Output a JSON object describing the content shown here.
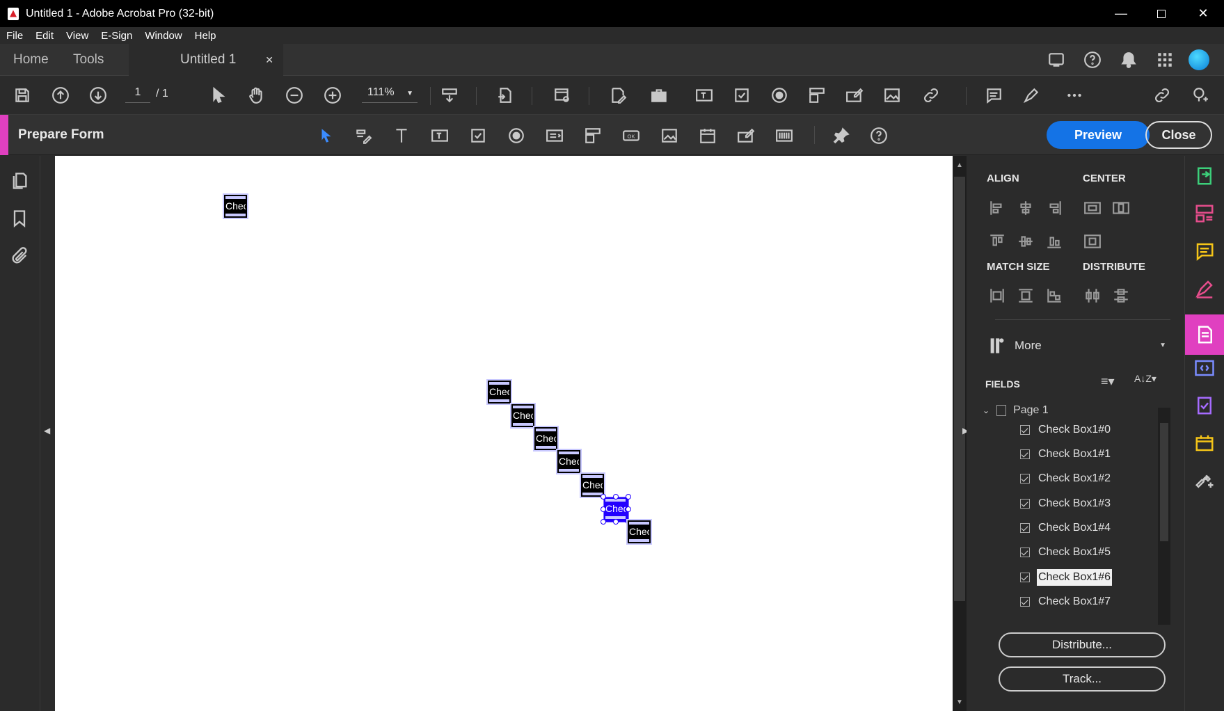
{
  "window": {
    "title": "Untitled 1 - Adobe Acrobat Pro (32-bit)"
  },
  "menu": [
    "File",
    "Edit",
    "View",
    "E-Sign",
    "Window",
    "Help"
  ],
  "tabs": {
    "home": "Home",
    "tools": "Tools",
    "doc": "Untitled 1"
  },
  "toolbar": {
    "page_current": "1",
    "page_total": "/ 1",
    "zoom": "111%"
  },
  "prepare": {
    "label": "Prepare Form",
    "preview": "Preview",
    "close": "Close"
  },
  "canvas": {
    "field_label": "Chec",
    "fields": [
      {
        "name": "Check Box1#0",
        "selected": false
      },
      {
        "name": "Check Box1#1",
        "selected": false
      },
      {
        "name": "Check Box1#2",
        "selected": false
      },
      {
        "name": "Check Box1#3",
        "selected": false
      },
      {
        "name": "Check Box1#4",
        "selected": false
      },
      {
        "name": "Check Box1#5",
        "selected": false
      },
      {
        "name": "Check Box1#6",
        "selected": true
      },
      {
        "name": "Check Box1#7",
        "selected": false
      }
    ]
  },
  "panel": {
    "align": "ALIGN",
    "center": "CENTER",
    "match_size": "MATCH SIZE",
    "distribute": "DISTRIBUTE",
    "more": "More",
    "fields_header": "FIELDS",
    "page_node": "Page 1",
    "field_list": [
      "Check Box1#0",
      "Check Box1#1",
      "Check Box1#2",
      "Check Box1#3",
      "Check Box1#4",
      "Check Box1#5",
      "Check Box1#6",
      "Check Box1#7"
    ],
    "selected_field": "Check Box1#6",
    "distribute_btn": "Distribute...",
    "track_btn": "Track..."
  },
  "colors": {
    "accent": "#1473e6",
    "tool_accent": "#e040c0",
    "selection": "#2200ff"
  }
}
